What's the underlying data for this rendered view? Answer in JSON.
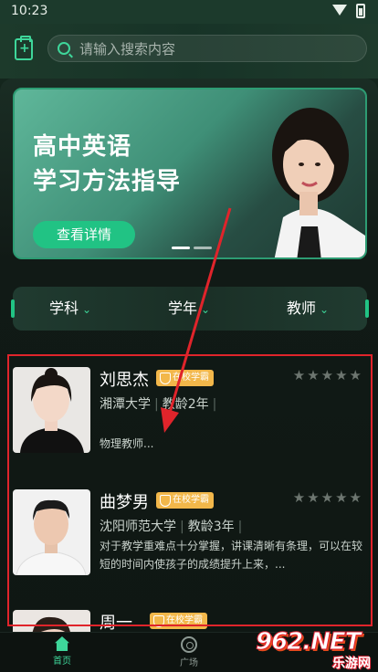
{
  "status_bar": {
    "time": "10:23"
  },
  "search": {
    "placeholder": "请输入搜索内容"
  },
  "banner": {
    "title_line1": "高中英语",
    "title_line2": "学习方法指导",
    "button_label": "查看详情"
  },
  "filters": [
    {
      "label": "学科"
    },
    {
      "label": "学年"
    },
    {
      "label": "教师"
    }
  ],
  "teachers": [
    {
      "name": "刘思杰",
      "badge": "在校学霸",
      "school": "湘潭大学",
      "experience": "教龄2年",
      "description": "物理教师..."
    },
    {
      "name": "曲梦男",
      "badge": "在校学霸",
      "school": "沈阳师范大学",
      "experience": "教龄3年",
      "description": "对于教学重难点十分掌握，讲课清晰有条理，可以在较短的时间内使孩子的成绩提升上来，..."
    },
    {
      "name": "周一",
      "badge": "在校学霸"
    }
  ],
  "bottom_nav": [
    {
      "label": "首页",
      "icon": "home-icon",
      "active": true
    },
    {
      "label": "广场",
      "icon": "plaza-icon",
      "active": false
    }
  ],
  "watermark": {
    "brand": "962.NET",
    "sub": "乐游网"
  },
  "colors": {
    "accent": "#21c384",
    "annotation": "#e0242b",
    "badge": "#f2b74a"
  }
}
